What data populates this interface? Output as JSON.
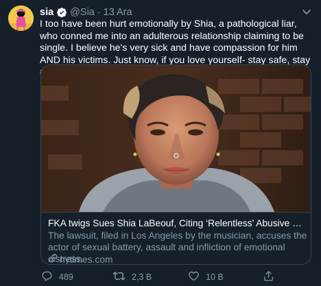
{
  "tweet": {
    "author": {
      "name": "sia",
      "handle": "@Sia",
      "separator": "·",
      "time": "13 Ara"
    },
    "text": "I too have been hurt emotionally by Shia, a pathological liar, who conned me into an adulterous relationship claiming to be single. I believe he's very sick and have compassion for him AND his victims. Just know, if you love yourself- stay safe, stay away.",
    "card": {
      "title": "FKA twigs Sues Shia LaBeouf, Citing ‘Relentless’ Abusive Relations...",
      "description": "The lawsuit, filed in Los Angeles by the musician, accuses the actor of sexual battery, assault and infliction of emotional distress.",
      "domain": "nytimes.com"
    },
    "actions": {
      "replies": "489",
      "retweets": "2,3 B",
      "likes": "10 B"
    }
  },
  "colors": {
    "background": "#15202b",
    "secondary_text": "#8899a6",
    "verified_badge": "#1da1f2",
    "border": "#38444d"
  },
  "icons": [
    "verified-badge-icon",
    "chevron-down-icon",
    "link-icon",
    "reply-icon",
    "retweet-icon",
    "like-icon",
    "share-icon"
  ]
}
